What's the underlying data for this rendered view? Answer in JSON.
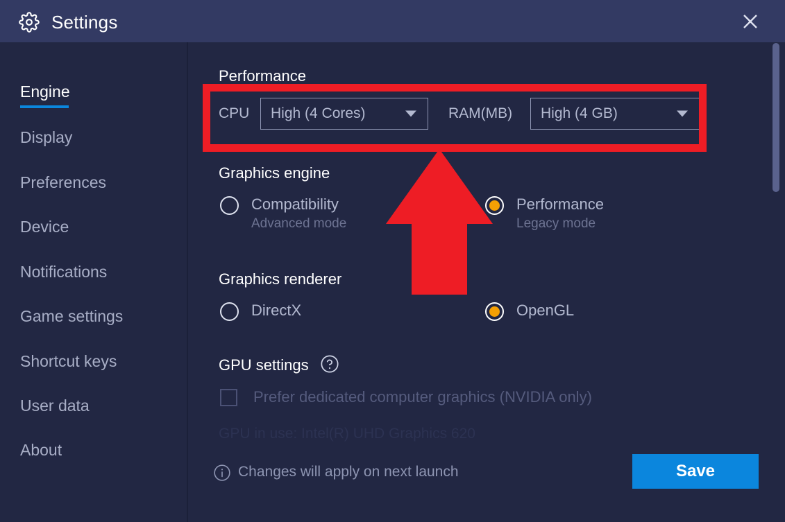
{
  "window": {
    "title": "Settings",
    "gear_icon": "gear-icon",
    "close_icon": "close-icon"
  },
  "sidebar": {
    "items": [
      {
        "label": "Engine",
        "active": true
      },
      {
        "label": "Display",
        "active": false
      },
      {
        "label": "Preferences",
        "active": false
      },
      {
        "label": "Device",
        "active": false
      },
      {
        "label": "Notifications",
        "active": false
      },
      {
        "label": "Game settings",
        "active": false
      },
      {
        "label": "Shortcut keys",
        "active": false
      },
      {
        "label": "User data",
        "active": false
      },
      {
        "label": "About",
        "active": false
      }
    ]
  },
  "main": {
    "performance": {
      "title": "Performance",
      "cpu_label": "CPU",
      "cpu_value": "High (4 Cores)",
      "ram_label": "RAM(MB)",
      "ram_value": "High (4 GB)",
      "caret_icon": "chevron-down-icon"
    },
    "graphics_engine": {
      "title": "Graphics engine",
      "options": [
        {
          "label": "Compatibility",
          "sub": "Advanced mode",
          "selected": false
        },
        {
          "label": "Performance",
          "sub": "Legacy mode",
          "selected": true
        }
      ]
    },
    "graphics_renderer": {
      "title": "Graphics renderer",
      "options": [
        {
          "label": "DirectX",
          "selected": false
        },
        {
          "label": "OpenGL",
          "selected": true
        }
      ]
    },
    "gpu_settings": {
      "title": "GPU settings",
      "help_icon": "question-mark-circle-icon",
      "checkbox_label": "Prefer dedicated computer graphics (NVIDIA only)",
      "checkbox_checked": false,
      "gpu_in_use": "GPU in use: Intel(R) UHD Graphics 620"
    }
  },
  "footer": {
    "info_icon": "info-circle-icon",
    "note": "Changes will apply on next launch",
    "save_label": "Save"
  },
  "colors": {
    "window_bg": "#222743",
    "titlebar_bg": "#333a63",
    "accent_blue": "#0b86dd",
    "radio_selected": "#f5a004",
    "annotation_red": "#ee1d25",
    "text_primary": "#ffffff",
    "text_secondary": "#b3b9d0",
    "text_muted": "#6d7392"
  },
  "annotations": {
    "highlight_box": "red-highlight-rectangle",
    "arrow": "red-up-arrow"
  }
}
